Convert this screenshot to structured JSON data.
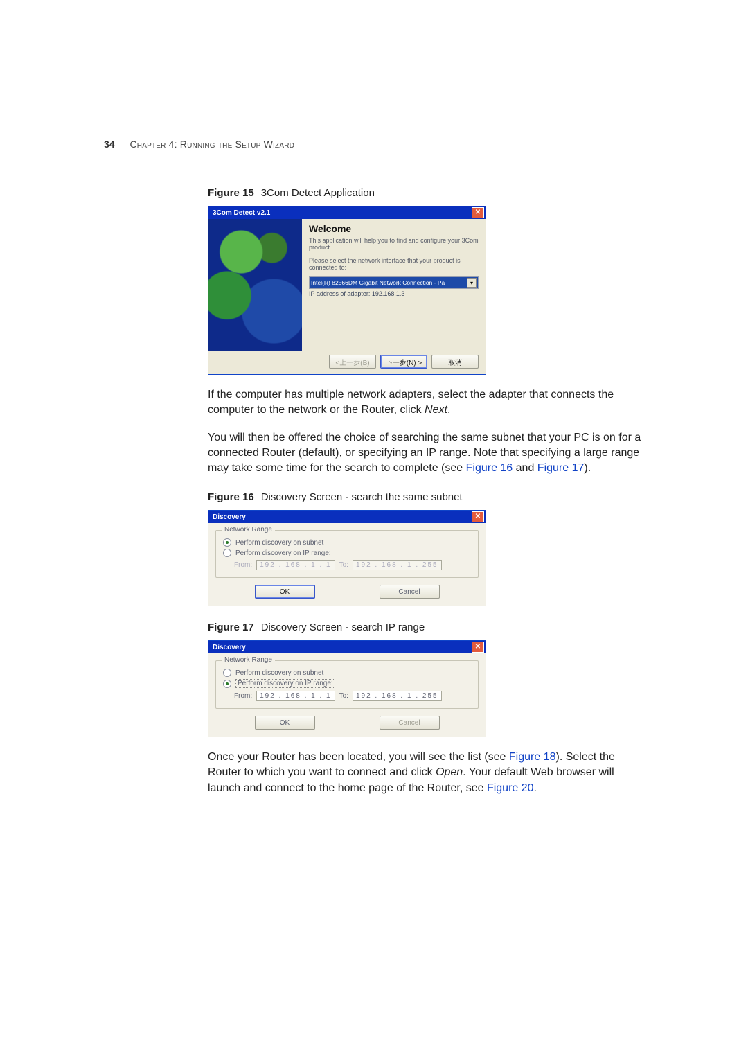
{
  "page": {
    "number": "34",
    "chapter_smallcaps": "Chapter 4: Running the Setup Wizard"
  },
  "fig15": {
    "label_prefix": "Figure 15",
    "label_text": "3Com Detect Application",
    "titlebar": "3Com Detect v2.1",
    "welcome_h": "Welcome",
    "welcome_p1": "This application will help you to find and configure your 3Com product.",
    "welcome_p2": "Please select the network interface that your product is connected to:",
    "nic_select": "Intel(R) 82566DM Gigabit Network Connection - Pa",
    "ip_line": "IP address of adapter: 192.168.1.3",
    "btn_back": "<上一步(B)",
    "btn_next": "下一步(N) >",
    "btn_cancel": "取消"
  },
  "para1_a": "If the computer has multiple network adapters, select the adapter that connects the computer to the network or the Router, click ",
  "para1_b": "Next",
  "para1_c": ".",
  "para2_a": "You will then be offered the choice of searching the same subnet that your PC is on for a connected Router (default), or specifying an IP range. Note that specifying a large range may take some time for the search to complete (see ",
  "para2_link1": "Figure 16",
  "para2_mid": " and ",
  "para2_link2": "Figure 17",
  "para2_end": ").",
  "fig16": {
    "label_prefix": "Figure 16",
    "label_text": "Discovery Screen - search the same subnet",
    "title": "Discovery",
    "group": "Network Range",
    "r1": "Perform discovery on subnet",
    "r2": "Perform discovery on IP range:",
    "from_lbl": "From:",
    "from_ip": "192 . 168 .  1  .  1",
    "to_lbl": "To:",
    "to_ip": "192 . 168 .  1  . 255",
    "ok": "OK",
    "cancel": "Cancel"
  },
  "fig17": {
    "label_prefix": "Figure 17",
    "label_text": "Discovery Screen - search IP range",
    "title": "Discovery",
    "group": "Network Range",
    "r1": "Perform discovery on subnet",
    "r2": "Perform discovery on IP range:",
    "from_lbl": "From:",
    "from_ip": "192 . 168 .  1  .  1",
    "to_lbl": "To:",
    "to_ip": "192 . 168 .  1  . 255",
    "ok": "OK",
    "cancel": "Cancel"
  },
  "para3_a": "Once your Router has been located, you will see the list (see ",
  "para3_link1": "Figure 18",
  "para3_b": "). Select the Router to which you want to connect and click ",
  "para3_open": "Open",
  "para3_c": ". Your default Web browser will launch and connect to the home page of the Router, see ",
  "para3_link2": "Figure 20",
  "para3_d": "."
}
